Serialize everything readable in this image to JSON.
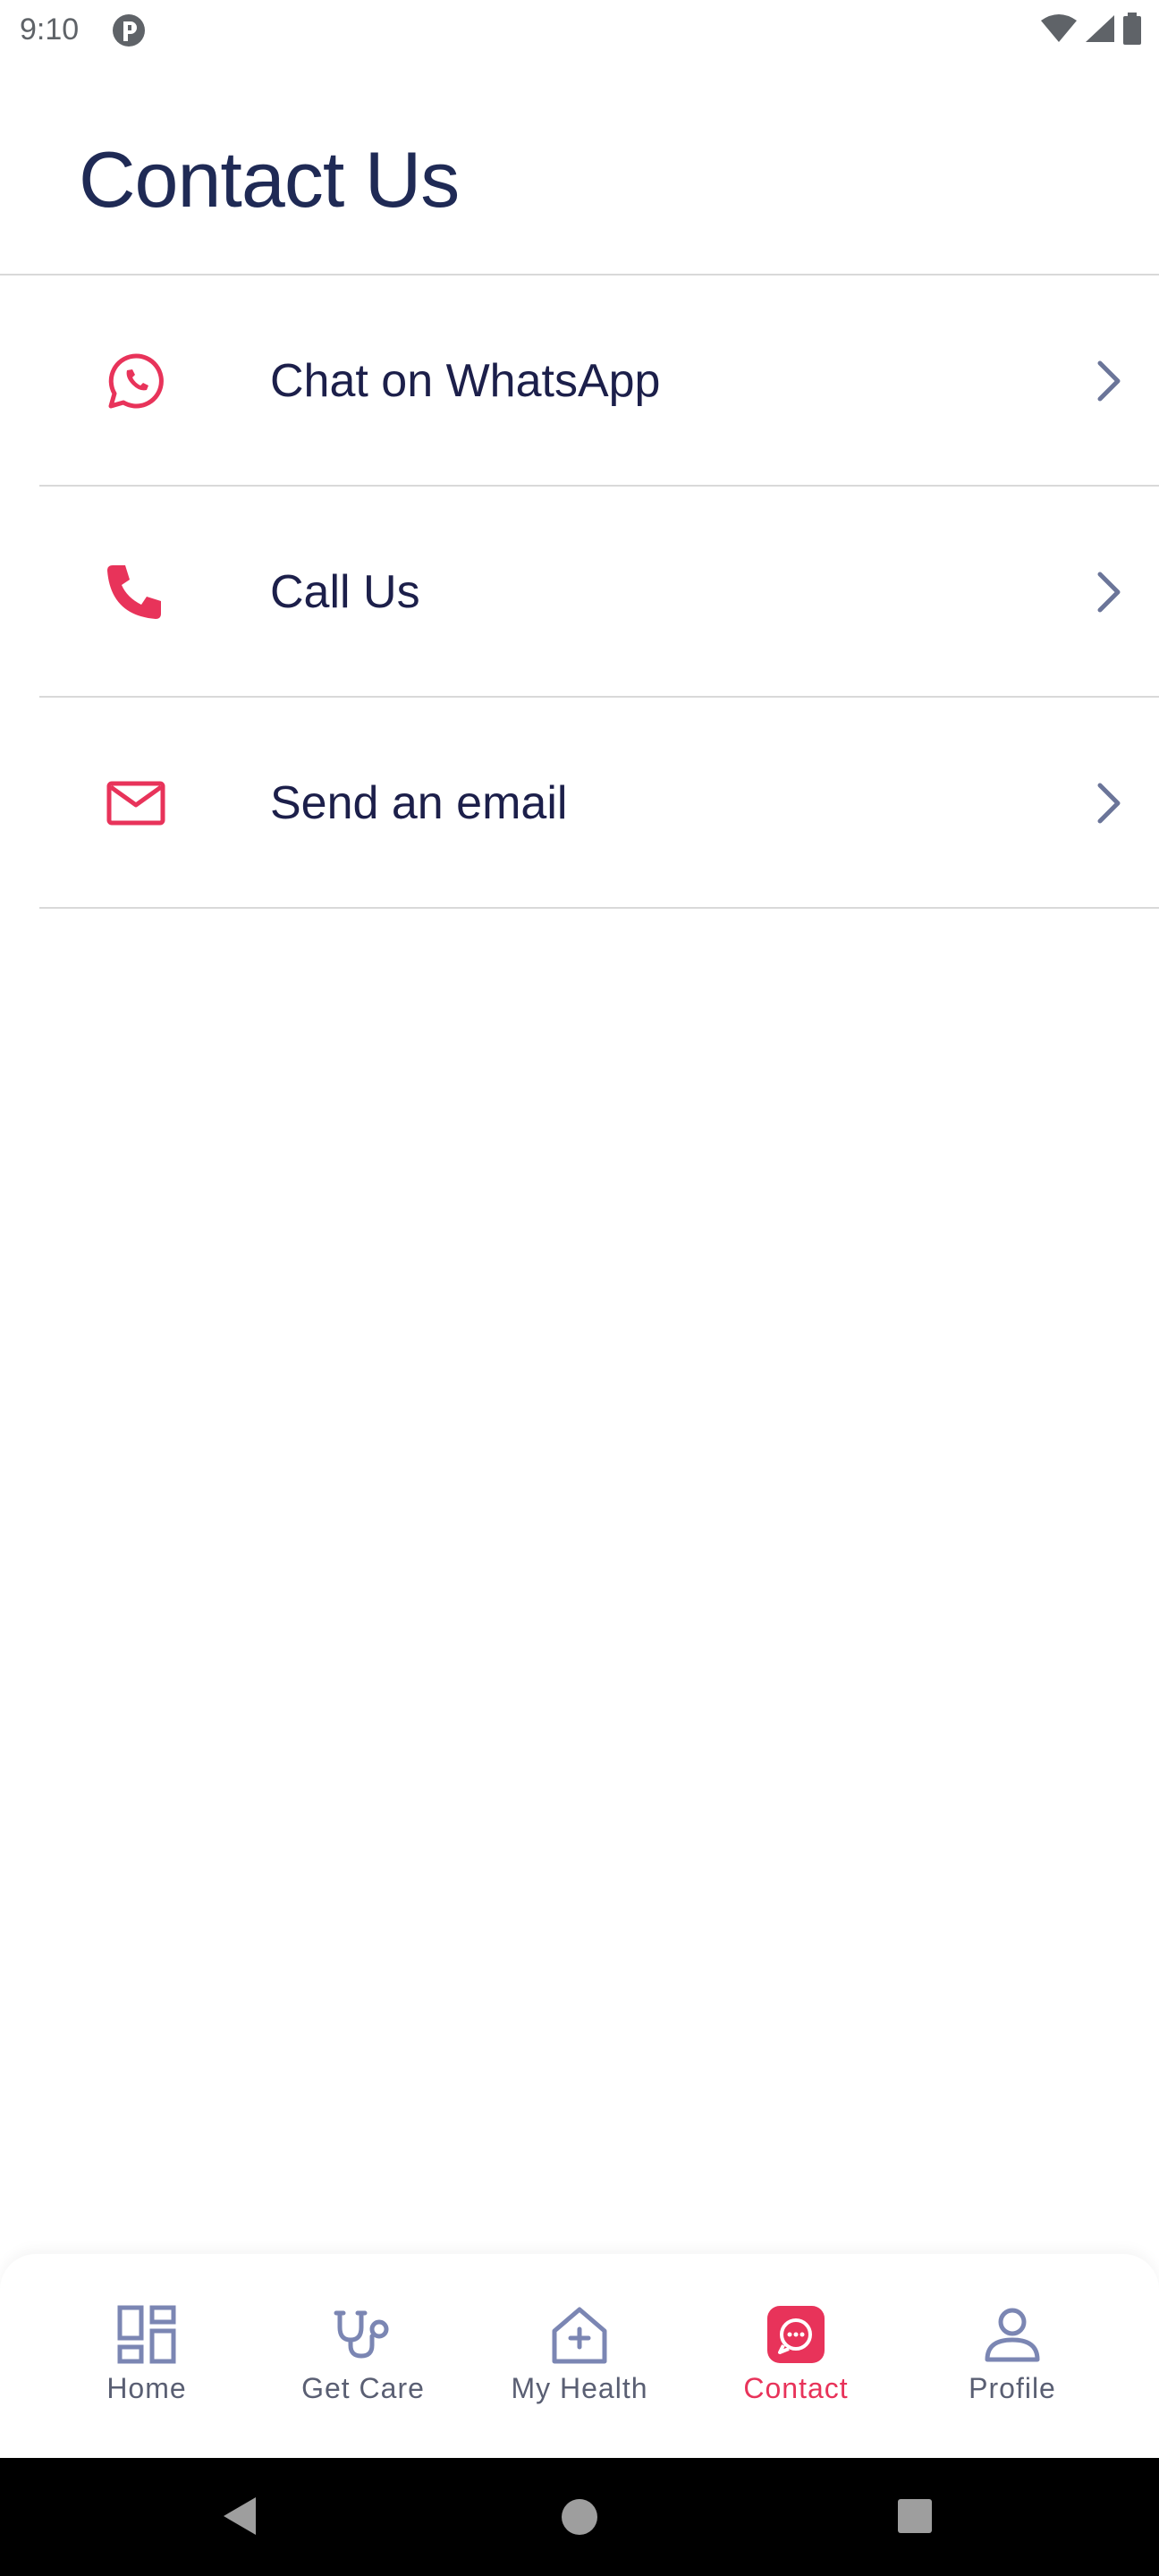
{
  "status_bar": {
    "time": "9:10"
  },
  "header": {
    "title": "Contact Us"
  },
  "contact_options": [
    {
      "label": "Chat on WhatsApp",
      "icon": "whatsapp-icon"
    },
    {
      "label": "Call Us",
      "icon": "phone-icon"
    },
    {
      "label": "Send an email",
      "icon": "email-icon"
    }
  ],
  "bottom_nav": {
    "items": [
      {
        "label": "Home",
        "icon": "dashboard-icon"
      },
      {
        "label": "Get Care",
        "icon": "stethoscope-icon"
      },
      {
        "label": "My Health",
        "icon": "health-house-icon"
      },
      {
        "label": "Contact",
        "icon": "chat-bubble-icon",
        "active": true
      },
      {
        "label": "Profile",
        "icon": "person-icon"
      }
    ]
  },
  "colors": {
    "accent": "#e8335a",
    "title": "#1f2a55",
    "nav_icon": "#7b86b3",
    "text": "#1c1f4a"
  }
}
